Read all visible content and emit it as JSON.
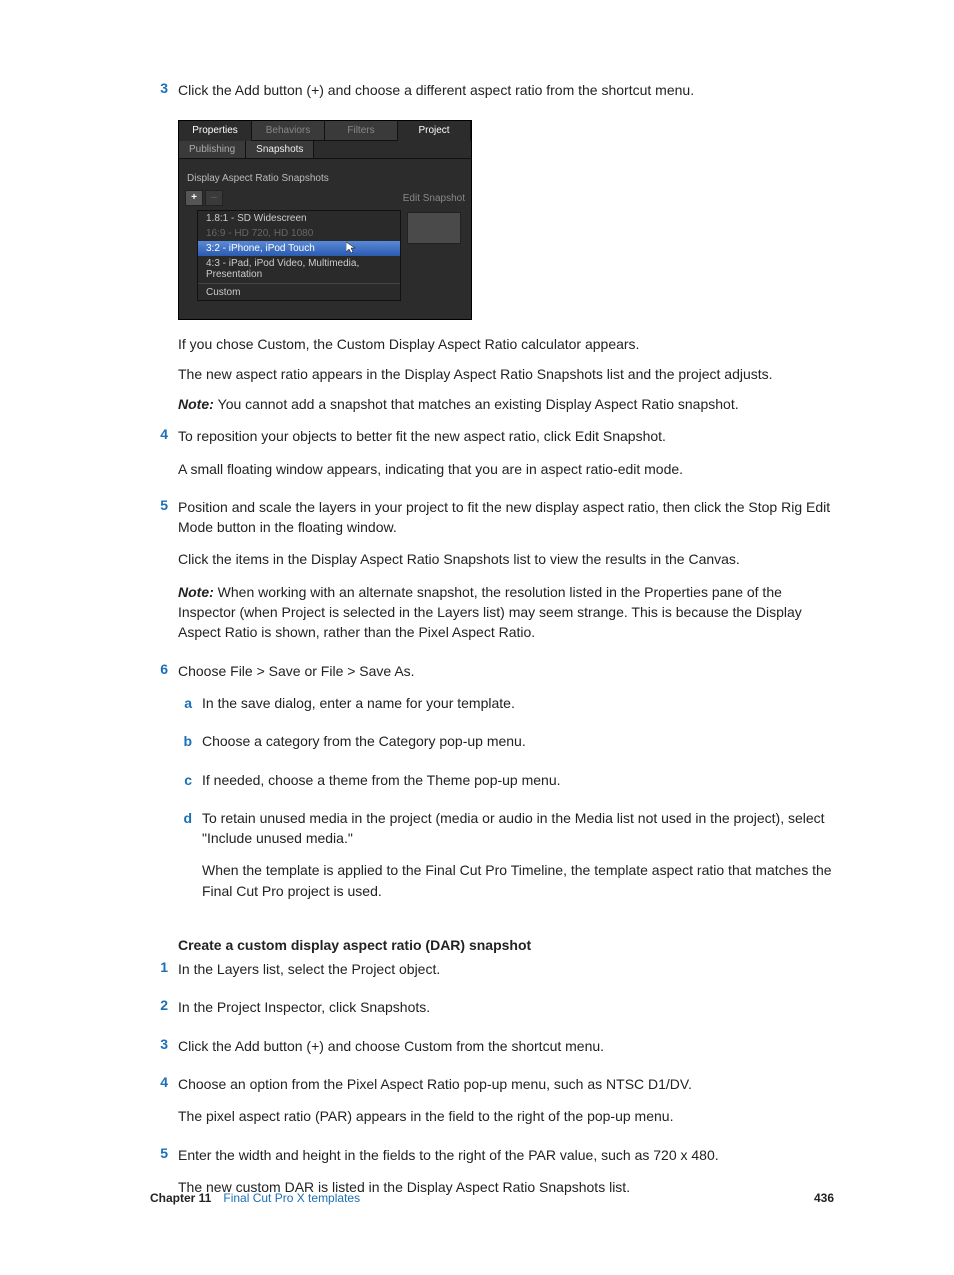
{
  "steps_main": {
    "s3": {
      "num": "3",
      "text": "Click the Add button (+) and choose a different aspect ratio from the shortcut menu.",
      "after1": "If you chose Custom, the Custom Display Aspect Ratio calculator appears.",
      "after2": "The new aspect ratio appears in the Display Aspect Ratio Snapshots list and the project adjusts.",
      "note_label": "Note:  ",
      "note": "You cannot add a snapshot that matches an existing Display Aspect Ratio snapshot."
    },
    "s4": {
      "num": "4",
      "text": "To reposition your objects to better fit the new aspect ratio, click Edit Snapshot.",
      "after": "A small floating window appears, indicating that you are in aspect ratio-edit mode."
    },
    "s5": {
      "num": "5",
      "text": "Position and scale the layers in your project to fit the new display aspect ratio, then click the Stop Rig Edit Mode button in the floating window.",
      "after": "Click the items in the Display Aspect Ratio Snapshots list to view the results in the Canvas.",
      "note_label": "Note:  ",
      "note": "When working with an alternate snapshot, the resolution listed in the Properties pane of the Inspector (when Project is selected in the Layers list) may seem strange. This is because the Display Aspect Ratio is shown, rather than the Pixel Aspect Ratio."
    },
    "s6": {
      "num": "6",
      "text": "Choose File > Save or File > Save As.",
      "subs": {
        "a": {
          "l": "a",
          "t": "In the save dialog, enter a name for your template."
        },
        "b": {
          "l": "b",
          "t": "Choose a category from the Category pop-up menu."
        },
        "c": {
          "l": "c",
          "t": "If needed, choose a theme from the Theme pop-up menu."
        },
        "d": {
          "l": "d",
          "t": "To retain unused media in the project (media or audio in the Media list not used in the project), select \"Include unused media.\"",
          "after": "When the template is applied to the Final Cut Pro Timeline, the template aspect ratio that matches the Final Cut Pro project is used."
        }
      }
    }
  },
  "section2": {
    "heading": "Create a custom display aspect ratio (DAR) snapshot",
    "s1": {
      "num": "1",
      "text": "In the Layers list, select the Project object."
    },
    "s2": {
      "num": "2",
      "text": "In the Project Inspector, click Snapshots."
    },
    "s3": {
      "num": "3",
      "text": "Click the Add button (+) and choose Custom from the shortcut menu."
    },
    "s4": {
      "num": "4",
      "text": "Choose an option from the Pixel Aspect Ratio pop-up menu, such as NTSC D1/DV.",
      "after": "The pixel aspect ratio (PAR) appears in the field to the right of the pop-up menu."
    },
    "s5": {
      "num": "5",
      "text": "Enter the width and height in the fields to the right of the PAR value, such as 720 x 480.",
      "after": "The new custom DAR is listed in the Display Aspect Ratio Snapshots list."
    }
  },
  "screenshot": {
    "tabs": {
      "properties": "Properties",
      "behaviors": "Behaviors",
      "filters": "Filters",
      "project": "Project"
    },
    "subtabs": {
      "publishing": "Publishing",
      "snapshots": "Snapshots"
    },
    "section": "Display Aspect Ratio Snapshots",
    "add": "+",
    "minus": "–",
    "edit": "Edit Snapshot",
    "menu": {
      "i0": "1.8:1 - SD Widescreen",
      "i1": "16:9 - HD 720, HD 1080",
      "i2": "3:2 - iPhone, iPod Touch",
      "i3": "4:3 - iPad, iPod Video, Multimedia, Presentation",
      "i4": "Custom"
    }
  },
  "footer": {
    "chapter": "Chapter 11",
    "title": "Final Cut Pro X templates",
    "page": "436"
  }
}
